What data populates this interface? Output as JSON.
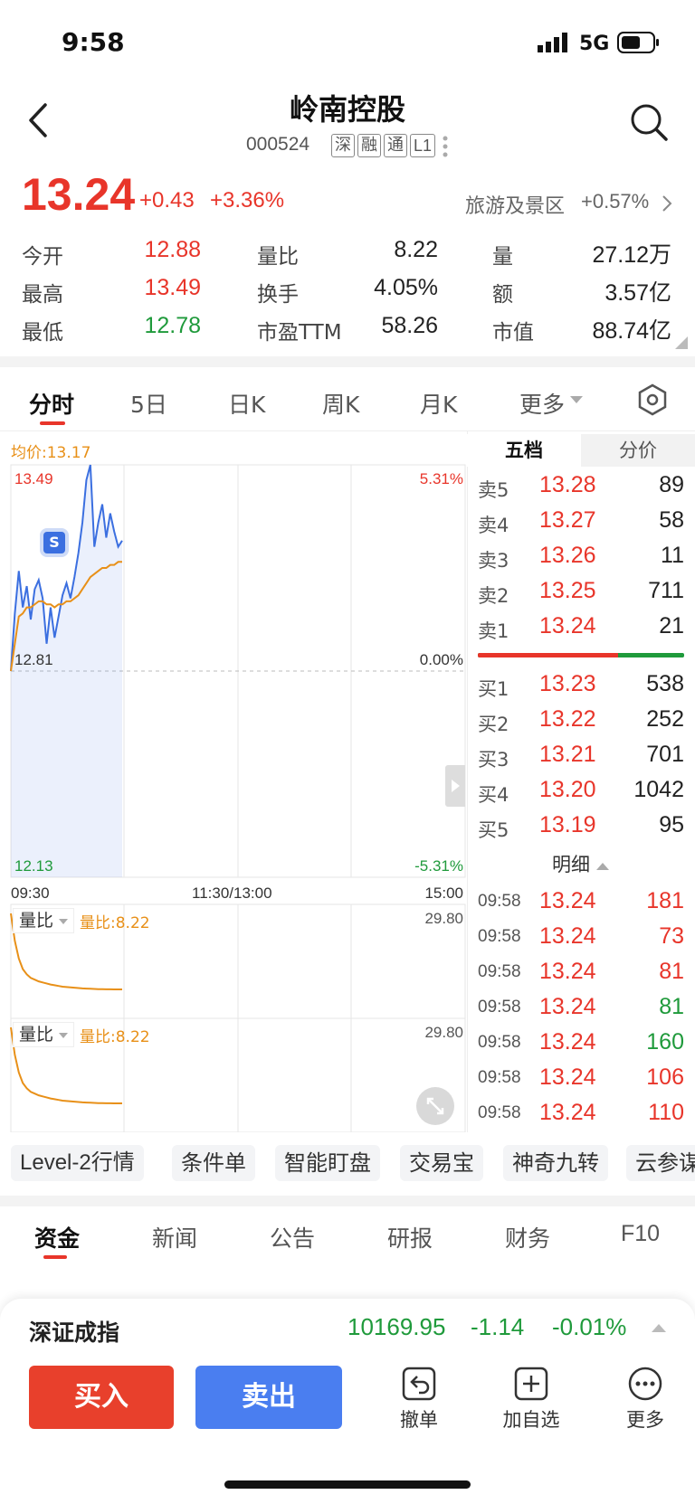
{
  "status_bar": {
    "time": "9:58",
    "network": "5G"
  },
  "header": {
    "title": "岭南控股",
    "code": "000524",
    "tags": [
      "深",
      "融",
      "通",
      "L1"
    ]
  },
  "quote": {
    "price": "13.24",
    "change": "+0.43",
    "change_pct": "+3.36%",
    "sector_name": "旅游及景区",
    "sector_change": "+0.57%"
  },
  "stats": [
    {
      "label": "今开",
      "value": "12.88",
      "color": "#e8352a"
    },
    {
      "label": "量比",
      "value": "8.22",
      "color": "#222222"
    },
    {
      "label": "量",
      "value": "27.12万",
      "color": "#222222"
    },
    {
      "label": "最高",
      "value": "13.49",
      "color": "#e8352a"
    },
    {
      "label": "换手",
      "value": "4.05%",
      "color": "#222222"
    },
    {
      "label": "额",
      "value": "3.57亿",
      "color": "#222222"
    },
    {
      "label": "最低",
      "value": "12.78",
      "color": "#1f9a3b"
    },
    {
      "label": "市盈TTM",
      "value": "58.26",
      "color": "#222222"
    },
    {
      "label": "市值",
      "value": "88.74亿",
      "color": "#222222"
    }
  ],
  "chart_tabs": [
    {
      "label": "分时",
      "active": true
    },
    {
      "label": "5日"
    },
    {
      "label": "日K"
    },
    {
      "label": "周K"
    },
    {
      "label": "月K"
    },
    {
      "label": "更多"
    }
  ],
  "chart": {
    "avg_price_label": "均价:13.17",
    "y_high": "13.49",
    "y_mid": "12.81",
    "y_low": "12.13",
    "pct_high": "5.31%",
    "pct_mid": "0.00%",
    "pct_low": "-5.31%",
    "badge": "S",
    "x_start": "09:30",
    "x_mid": "11:30/13:00",
    "x_end": "15:00",
    "sub_indicator": "量比",
    "sub_value_label": "量比:8.22",
    "sub_axis_max": "29.80"
  },
  "chart_data": {
    "type": "line",
    "title": "",
    "x": [
      "09:30",
      "09:31",
      "09:32",
      "09:33",
      "09:34",
      "09:35",
      "09:36",
      "09:37",
      "09:38",
      "09:39",
      "09:40",
      "09:41",
      "09:42",
      "09:43",
      "09:44",
      "09:45",
      "09:46",
      "09:47",
      "09:48",
      "09:49",
      "09:50",
      "09:51",
      "09:52",
      "09:53",
      "09:54",
      "09:55",
      "09:56",
      "09:57",
      "09:58"
    ],
    "series": [
      {
        "name": "",
        "color": "#3b6fe0",
        "values": [
          12.81,
          13.0,
          13.14,
          13.02,
          13.09,
          12.98,
          13.08,
          13.11,
          13.05,
          12.9,
          13.02,
          12.92,
          12.99,
          13.06,
          13.1,
          13.05,
          13.12,
          13.2,
          13.3,
          13.44,
          13.49,
          13.22,
          13.3,
          13.36,
          13.25,
          13.33,
          13.27,
          13.22,
          13.24
        ]
      },
      {
        "name": "均价",
        "color": "#e89018",
        "values": [
          12.81,
          12.9,
          12.99,
          13.0,
          13.02,
          13.02,
          13.03,
          13.04,
          13.04,
          13.03,
          13.03,
          13.02,
          13.03,
          13.03,
          13.04,
          13.04,
          13.05,
          13.06,
          13.08,
          13.1,
          13.12,
          13.13,
          13.14,
          13.15,
          13.15,
          13.16,
          13.16,
          13.17,
          13.17
        ]
      }
    ],
    "ylim": [
      12.13,
      13.49
    ],
    "sub_charts": [
      {
        "name": "量比",
        "ylim": [
          0,
          29.8
        ],
        "values": [
          29.8,
          22.0,
          17.0,
          14.0,
          12.5,
          11.5,
          11.0,
          10.5,
          10.2,
          9.9,
          9.6,
          9.4,
          9.2,
          9.0,
          8.9,
          8.8,
          8.7,
          8.6,
          8.5,
          8.45,
          8.4,
          8.35,
          8.3,
          8.3,
          8.25,
          8.25,
          8.22,
          8.22,
          8.22
        ]
      },
      {
        "name": "量比",
        "ylim": [
          0,
          29.8
        ],
        "values": [
          29.8,
          22.0,
          17.0,
          14.0,
          12.5,
          11.5,
          11.0,
          10.5,
          10.2,
          9.9,
          9.6,
          9.4,
          9.2,
          9.0,
          8.9,
          8.8,
          8.7,
          8.6,
          8.5,
          8.45,
          8.4,
          8.35,
          8.3,
          8.3,
          8.25,
          8.25,
          8.22,
          8.22,
          8.22
        ]
      }
    ]
  },
  "order_book": {
    "tabs": [
      "五档",
      "分价"
    ],
    "asks": [
      {
        "label": "卖5",
        "price": "13.28",
        "vol": "89"
      },
      {
        "label": "卖4",
        "price": "13.27",
        "vol": "58"
      },
      {
        "label": "卖3",
        "price": "13.26",
        "vol": "11"
      },
      {
        "label": "卖2",
        "price": "13.25",
        "vol": "711"
      },
      {
        "label": "卖1",
        "price": "13.24",
        "vol": "21"
      }
    ],
    "bids": [
      {
        "label": "买1",
        "price": "13.23",
        "vol": "538"
      },
      {
        "label": "买2",
        "price": "13.22",
        "vol": "252"
      },
      {
        "label": "买3",
        "price": "13.21",
        "vol": "701"
      },
      {
        "label": "买4",
        "price": "13.20",
        "vol": "1042"
      },
      {
        "label": "买5",
        "price": "13.19",
        "vol": "95"
      }
    ],
    "ratio_red": 0.68,
    "details_label": "明细",
    "ticks": [
      {
        "time": "09:58",
        "price": "13.24",
        "vol": "181",
        "color": "#e8352a"
      },
      {
        "time": "09:58",
        "price": "13.24",
        "vol": "73",
        "color": "#e8352a"
      },
      {
        "time": "09:58",
        "price": "13.24",
        "vol": "81",
        "color": "#e8352a"
      },
      {
        "time": "09:58",
        "price": "13.24",
        "vol": "81",
        "color": "#1f9a3b"
      },
      {
        "time": "09:58",
        "price": "13.24",
        "vol": "160",
        "color": "#1f9a3b"
      },
      {
        "time": "09:58",
        "price": "13.24",
        "vol": "106",
        "color": "#e8352a"
      },
      {
        "time": "09:58",
        "price": "13.24",
        "vol": "110",
        "color": "#e8352a"
      }
    ]
  },
  "tools": [
    "Level-2行情",
    "条件单",
    "智能盯盘",
    "交易宝",
    "神奇九转",
    "云参谋"
  ],
  "bottom_tabs": [
    {
      "label": "资金",
      "active": true
    },
    {
      "label": "新闻"
    },
    {
      "label": "公告"
    },
    {
      "label": "研报"
    },
    {
      "label": "财务"
    },
    {
      "label": "F10"
    }
  ],
  "index_bar": {
    "name": "深证成指",
    "value": "10169.95",
    "change": "-1.14",
    "change_pct": "-0.01%"
  },
  "actions": {
    "buy": "买入",
    "sell": "卖出",
    "cancel": "撤单",
    "add_watch": "加自选",
    "more": "更多"
  },
  "colors": {
    "up": "#e8352a",
    "down": "#1f9a3b",
    "avg": "#e89018",
    "line": "#3b6fe0",
    "buy_btn": "#e8402c",
    "sell_btn": "#4a7ef0"
  }
}
